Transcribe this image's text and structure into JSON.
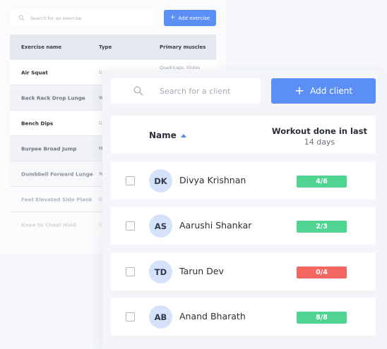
{
  "exercises": {
    "search_placeholder": "Search for an exercise",
    "add_label": "Add exercise",
    "columns": {
      "name": "Exercise name",
      "type": "Type",
      "muscles": "Primary muscles"
    },
    "rows": [
      {
        "name": "Air Squat",
        "type": "Gy",
        "muscles": "Quadriceps, Glutes"
      },
      {
        "name": "Back Rack Drop Lunge",
        "type": "W"
      },
      {
        "name": "Bench Dips",
        "type": "Gy"
      },
      {
        "name": "Burpee Broad Jump",
        "type": "Mo"
      },
      {
        "name": "Dumbbell Forward Lunge",
        "type": "W"
      },
      {
        "name": "Feet Elevated Side Plank",
        "type": "Gy"
      },
      {
        "name": "Knee to Chest Hold",
        "type": "Gy"
      }
    ]
  },
  "clients": {
    "search_placeholder": "Search for a client",
    "add_label": "Add client",
    "columns": {
      "name": "Name",
      "workout_line1": "Workout done in last",
      "workout_line2": "14 days"
    },
    "rows": [
      {
        "initials": "DK",
        "name": "Divya Krishnan",
        "done": "4/6",
        "status": "green"
      },
      {
        "initials": "AS",
        "name": "Aarushi Shankar",
        "done": "2/3",
        "status": "green"
      },
      {
        "initials": "TD",
        "name": "Tarun Dev",
        "done": "0/4",
        "status": "red"
      },
      {
        "initials": "AB",
        "name": "Anand Bharath",
        "done": "8/8",
        "status": "green"
      }
    ]
  },
  "colors": {
    "accent": "#5b8ff6",
    "success": "#4fd492",
    "danger": "#f2675f",
    "avatar_bg": "#d4e2fb"
  }
}
